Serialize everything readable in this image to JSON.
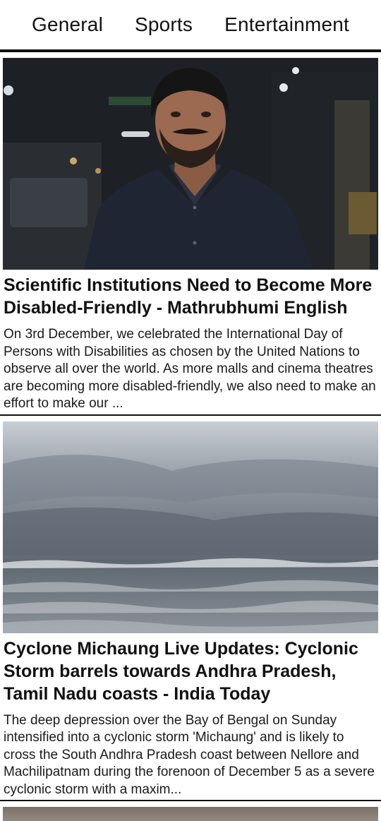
{
  "tabs": [
    {
      "label": "General"
    },
    {
      "label": "Sports"
    },
    {
      "label": "Entertainment"
    }
  ],
  "articles": [
    {
      "title": "Scientific Institutions Need to Become More Disabled-Friendly - Mathrubhumi English",
      "description": "On 3rd December, we celebrated the International Day of Persons with Disabilities as chosen by the United Nations to observe all over the world. As more malls and cinema theatres are becoming more disabled-friendly, we also need to make an effort to make our ..."
    },
    {
      "title": "Cyclone Michaung Live Updates: Cyclonic Storm barrels towards Andhra Pradesh, Tamil Nadu coasts - India Today",
      "description": "The deep depression over the Bay of Bengal on Sunday intensified into a cyclonic storm 'Michaung' and is likely to cross the South Andhra Pradesh coast between Nellore and Machilipatnam during the forenoon of December 5 as a severe cyclonic storm with a maxim..."
    }
  ]
}
